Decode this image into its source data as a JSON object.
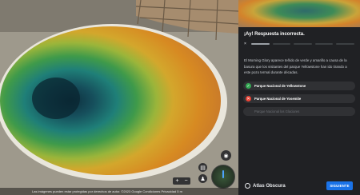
{
  "scene": {
    "attribution": "Las imágenes pueden estar protegidas por derechos de autor.   ©2023 Google   Condiciones   Privacidad   5 m",
    "zoom_in_label": "+",
    "zoom_out_label": "−",
    "icons": [
      "fullscreen-icon",
      "compass-icon",
      "layers-icon",
      "pegman-icon"
    ]
  },
  "quiz": {
    "result_title": "¡Ay! Respuesta incorrecta.",
    "progress_close": "×",
    "progress_steps": 5,
    "progress_current": 1,
    "explanation": "El Morning Glory aparece teñido de verde y amarillo a causa de la basura que los visitantes del parque Yellowstone han ido tirando a este pozo termal durante décadas.",
    "options": [
      {
        "label": "Parque Nacional de Yellowstone",
        "state": "correct",
        "icon": "check-icon",
        "symbol": "✓",
        "color": "#34a853"
      },
      {
        "label": "Parque Nacional de Yosemite",
        "state": "incorrect",
        "icon": "close-icon",
        "symbol": "✕",
        "color": "#ea4335"
      },
      {
        "label": "Parque Nacional los Glaciares",
        "state": "disabled",
        "icon": "",
        "symbol": "",
        "color": "#5f6368"
      }
    ],
    "brand": "Atlas Obscura",
    "next_label": "SIGUIENTE"
  }
}
